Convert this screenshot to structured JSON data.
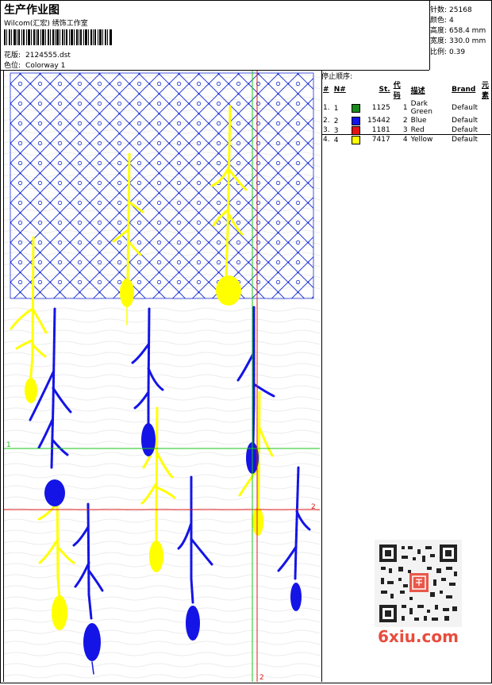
{
  "header": {
    "title": "生产作业图",
    "company": "Wilcom(汇宏) 绣饰工作室",
    "design_label": "花版:",
    "design_value": "2124555.dst",
    "colorway_label": "色位:",
    "colorway_value": "Colorway 1"
  },
  "stats": {
    "stitches_label": "针数:",
    "stitches": "25168",
    "colors_label": "颜色:",
    "colors": "4",
    "height_label": "高度:",
    "height": "658.4 mm",
    "width_label": "宽度:",
    "width": "330.0 mm",
    "scale_label": "比例:",
    "scale": "0.39"
  },
  "stop_sequence": {
    "heading": "停止顺序:",
    "columns": [
      "#",
      "N#",
      "St.",
      "代码",
      "描述",
      "Brand",
      "元素"
    ],
    "rows": [
      {
        "num": "1.",
        "n": "1",
        "color": "#1a8a1a",
        "st": "1125",
        "code": "1",
        "desc": "Dark Green",
        "brand": "Default"
      },
      {
        "num": "2.",
        "n": "2",
        "color": "#1414e6",
        "st": "15442",
        "code": "2",
        "desc": "Blue",
        "brand": "Default"
      },
      {
        "num": "3.",
        "n": "3",
        "color": "#e61414",
        "st": "1181",
        "code": "3",
        "desc": "Red",
        "brand": "Default"
      },
      {
        "num": "4.",
        "n": "4",
        "color": "#ffff00",
        "st": "7417",
        "code": "4",
        "desc": "Yellow",
        "brand": "Default"
      }
    ]
  },
  "guides": {
    "h1": "1",
    "h2": "2",
    "v2": "2"
  },
  "watermark": "6xiu.com",
  "colors": {
    "yellow": "#ffff00",
    "blue": "#1414e6",
    "net": "#1a2fd6",
    "green": "#19c419",
    "red": "#e01818"
  }
}
